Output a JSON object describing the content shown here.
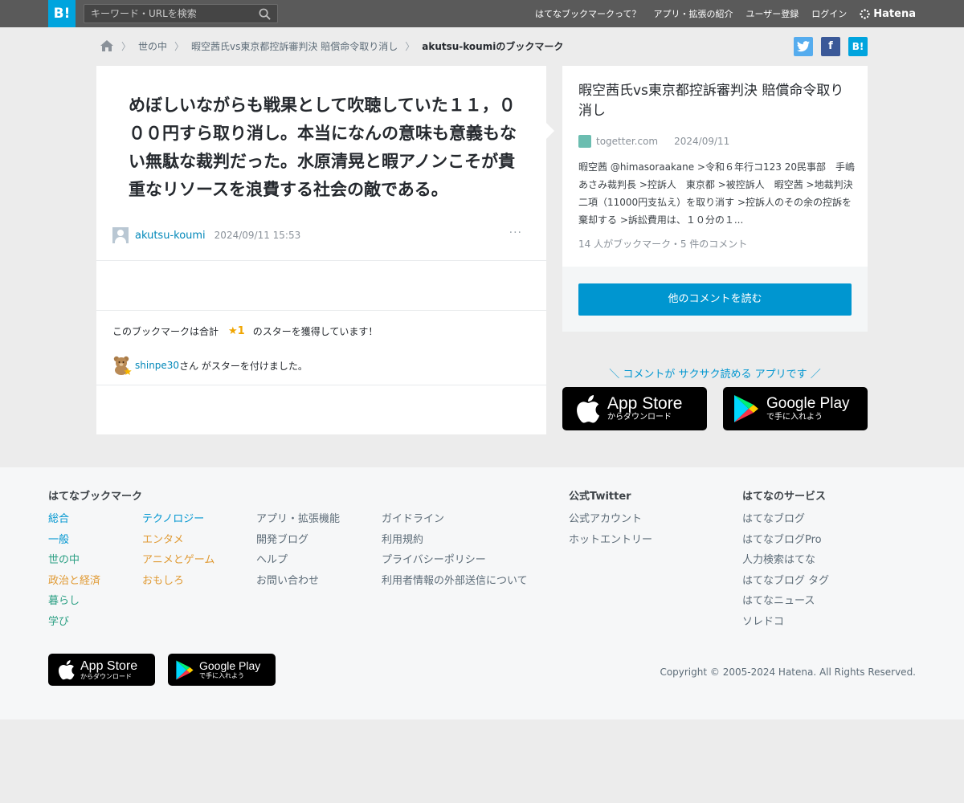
{
  "header": {
    "logo": "B!",
    "search_placeholder": "キーワード・URLを検索",
    "nav": [
      "はてなブックマークって？",
      "アプリ・拡張の紹介",
      "ユーザー登録",
      "ログイン"
    ],
    "brand": "Hatena"
  },
  "breadcrumb": {
    "items": [
      "世の中",
      "暇空茜氏vs東京都控訴審判決 賠償命令取り消し"
    ],
    "current": "akutsu-koumiのブックマーク"
  },
  "comment": {
    "text": "めぼしいながらも戦果として吹聴していた１１，０００円すら取り消し。本当になんの意味も意義もない無駄な裁判だった。水原清晃と暇アノンこそが貴重なリソースを浪費する社会の敵である。",
    "user": "akutsu-koumi",
    "timestamp": "2024/09/11 15:53",
    "more": "···"
  },
  "stars": {
    "prefix": "このブックマークは合計",
    "count": "★1",
    "suffix": "のスターを獲得しています！",
    "giver": "shinpe30",
    "giver_suffix": "さん がスターを付けました。"
  },
  "entry": {
    "title": "暇空茜氏vs東京都控訴審判決 賠償命令取り消し",
    "domain": "togetter.com",
    "date": "2024/09/11",
    "excerpt": "暇空茜 @himasoraakane >令和６年行コ123 20民事部　手嶋あさみ裁判長 >控訴人　東京都 >被控訴人　暇空茜 >地裁判決二項（11000円支払え）を取り消す >控訴人のその余の控訴を棄却する >訴訟費用は、１０分の１...",
    "counts": "14 人がブックマーク・5 件のコメント",
    "read_more": "他のコメントを読む"
  },
  "promo": {
    "text": "＼ コメントが サクサク読める アプリです ／",
    "appstore_big": "App Store",
    "appstore_small": "からダウンロード",
    "googleplay_big": "Google Play",
    "googleplay_small": "で手に入れよう"
  },
  "footer": {
    "bookmark_heading": "はてなブックマーク",
    "categories_col1": [
      "総合",
      "一般",
      "世の中",
      "政治と経済",
      "暮らし",
      "学び"
    ],
    "categories_col2": [
      "テクノロジー",
      "エンタメ",
      "アニメとゲーム",
      "おもしろ"
    ],
    "links_col3": [
      "アプリ・拡張機能",
      "開発ブログ",
      "ヘルプ",
      "お問い合わせ"
    ],
    "links_col4": [
      "ガイドライン",
      "利用規約",
      "プライバシーポリシー",
      "利用者情報の外部送信について"
    ],
    "twitter_heading": "公式Twitter",
    "twitter_links": [
      "公式アカウント",
      "ホットエントリー"
    ],
    "services_heading": "はてなのサービス",
    "services": [
      "はてなブログ",
      "はてなブログPro",
      "人力検索はてな",
      "はてなブログ タグ",
      "はてなニュース",
      "ソレドコ"
    ],
    "copyright": "Copyright © 2005-2024 Hatena. All Rights Reserved."
  },
  "colors": {
    "brand_blue": "#00a4de",
    "link_blue": "#0087b9",
    "category_blue": "#0096d0",
    "category_orange": "#e09a33",
    "category_teal": "#2a9f83"
  }
}
